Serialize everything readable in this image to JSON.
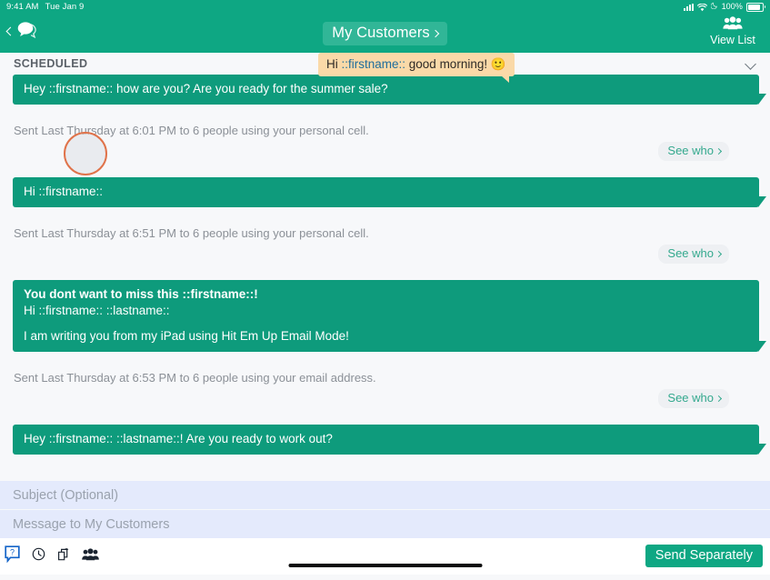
{
  "status_bar": {
    "time": "9:41 AM",
    "date": "Tue Jan 9",
    "battery_percent": "100%",
    "icons": [
      "cellular-signal-icon",
      "wifi-icon",
      "moon-icon",
      "battery-icon"
    ]
  },
  "nav": {
    "back_icon": "chevron-left-icon",
    "messages_icon": "chat-bubble-icon",
    "title": "My Customers",
    "title_chevron": "chevron-right-icon",
    "view_list_label": "View List",
    "view_list_icon": "group-people-icon"
  },
  "section": {
    "label": "SCHEDULED",
    "collapse_icon": "chevron-down-icon"
  },
  "tooltip": {
    "prefix": "Hi ",
    "placeholder": "::firstname::",
    "suffix": " good morning! ",
    "emoji": "🙂"
  },
  "messages": [
    {
      "lines": [
        {
          "text": "Hey ::firstname:: how are you? Are you ready for the summer sale?",
          "bold": false
        }
      ],
      "sent_meta": "Sent Last Thursday at 6:01 PM to 6 people using your personal cell.",
      "see_who_label": "See who"
    },
    {
      "lines": [
        {
          "text": "Hi ::firstname::",
          "bold": false
        }
      ],
      "sent_meta": "Sent Last Thursday at 6:51 PM to 6 people using your personal cell.",
      "see_who_label": "See who"
    },
    {
      "lines": [
        {
          "text": "You dont want to miss this ::firstname::!",
          "bold": true
        },
        {
          "text": "Hi ::firstname:: ::lastname::",
          "bold": false
        },
        {
          "text": "",
          "bold": false
        },
        {
          "text": "I am writing you from my iPad using Hit Em Up Email Mode!",
          "bold": false
        }
      ],
      "sent_meta": "Sent Last Thursday at 6:53 PM to 6 people using your email address.",
      "see_who_label": "See who"
    },
    {
      "lines": [
        {
          "text": "Hey ::firstname:: ::lastname::! Are you ready to work out?",
          "bold": false
        }
      ],
      "sent_meta": "",
      "see_who_label": ""
    }
  ],
  "composer": {
    "subject_placeholder": "Subject (Optional)",
    "subject_value": "",
    "message_placeholder": "Message to My Customers",
    "message_value": "",
    "tools": [
      {
        "name": "help-question-icon",
        "glyph": "?"
      },
      {
        "name": "clock-icon",
        "glyph": "⊙"
      },
      {
        "name": "duplicate-copy-icon",
        "glyph": "⧉"
      },
      {
        "name": "group-people-icon",
        "glyph": "👥"
      }
    ],
    "send_label": "Send Separately"
  },
  "colors": {
    "brand_green": "#0ea783",
    "bubble_green": "#0e9b7c",
    "tooltip_orange": "#fad9a8",
    "field_blue": "#e4eafc",
    "page_bg": "#f7f8fa",
    "cursor_ring": "#e0734a",
    "help_blue": "#1464c8"
  }
}
